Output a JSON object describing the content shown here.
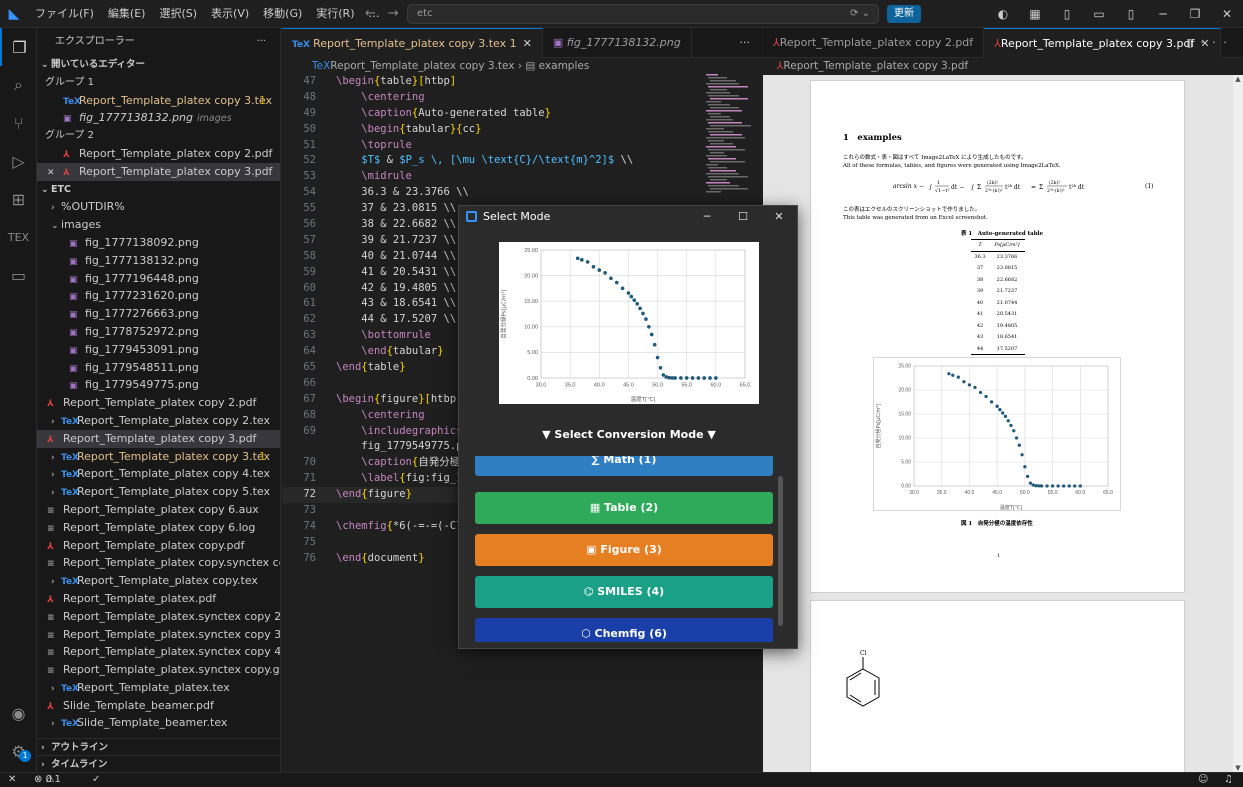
{
  "titlebar": {
    "menu": [
      "ファイル(F)",
      "編集(E)",
      "選択(S)",
      "表示(V)",
      "移動(G)",
      "実行(R)",
      "…"
    ],
    "search": "etc",
    "update_label": "更新"
  },
  "sidebar": {
    "header": "エクスプローラー",
    "open_editors_label": "開いているエディター",
    "group1_label": "グループ 1",
    "group1_items": [
      {
        "name": "Report_Template_platex copy 3.tex",
        "count": "1"
      },
      {
        "name": "fig_1777138132.png",
        "desc": "images"
      }
    ],
    "group2_label": "グループ 2",
    "group2_items": [
      {
        "name": "Report_Template_platex copy 2.pdf"
      },
      {
        "name": "Report_Template_platex copy 3.pdf"
      }
    ],
    "folder_label": "ETC",
    "folders": [
      "%OUTDIR%",
      "images"
    ],
    "images": [
      "fig_1777138092.png",
      "fig_1777138132.png",
      "fig_1777196448.png",
      "fig_1777231620.png",
      "fig_1777276663.png",
      "fig_1778752972.png",
      "fig_1779453091.png",
      "fig_1779548511.png",
      "fig_1779549775.png"
    ],
    "files": [
      {
        "name": "Report_Template_platex copy 2.pdf",
        "t": "pdf",
        "lv": 0
      },
      {
        "name": "Report_Template_platex copy 2.tex",
        "t": "tex",
        "lv": 1
      },
      {
        "name": "Report_Template_platex copy 3.pdf",
        "t": "pdf",
        "lv": 0,
        "sel": true
      },
      {
        "name": "Report_Template_platex copy 3.tex",
        "t": "tex",
        "lv": 1,
        "mod": true,
        "count": "1"
      },
      {
        "name": "Report_Template_platex copy 4.tex",
        "t": "tex",
        "lv": 1
      },
      {
        "name": "Report_Template_platex copy 5.tex",
        "t": "tex",
        "lv": 1
      },
      {
        "name": "Report_Template_platex copy 6.aux",
        "t": "file",
        "lv": 0
      },
      {
        "name": "Report_Template_platex copy 6.log",
        "t": "file",
        "lv": 0
      },
      {
        "name": "Report_Template_platex copy.pdf",
        "t": "pdf",
        "lv": 0
      },
      {
        "name": "Report_Template_platex copy.synctex copy.gz",
        "t": "file",
        "lv": 0
      },
      {
        "name": "Report_Template_platex copy.tex",
        "t": "tex",
        "lv": 1
      },
      {
        "name": "Report_Template_platex.pdf",
        "t": "pdf",
        "lv": 0
      },
      {
        "name": "Report_Template_platex.synctex copy 2.gz",
        "t": "file",
        "lv": 0
      },
      {
        "name": "Report_Template_platex.synctex copy 3.gz",
        "t": "file",
        "lv": 0
      },
      {
        "name": "Report_Template_platex.synctex copy 4.gz",
        "t": "file",
        "lv": 0
      },
      {
        "name": "Report_Template_platex.synctex copy.gz",
        "t": "file",
        "lv": 0
      },
      {
        "name": "Report_Template_platex.tex",
        "t": "tex",
        "lv": 1
      },
      {
        "name": "Slide_Template_beamer.pdf",
        "t": "pdf",
        "lv": 0
      },
      {
        "name": "Slide_Template_beamer.tex",
        "t": "tex",
        "lv": 1
      }
    ],
    "outline_label": "アウトライン",
    "timeline_label": "タイムライン"
  },
  "editor": {
    "tabs": [
      {
        "name": "Report_Template_platex copy 3.tex",
        "count": "1"
      },
      {
        "name": "fig_1777138132.png"
      }
    ],
    "breadcrumb_file": "Report_Template_platex copy 3.tex",
    "breadcrumb_sym": "examples",
    "lines": [
      {
        "n": "47",
        "t": "\\begin{table}[htbp]"
      },
      {
        "n": "48",
        "t": "    \\centering"
      },
      {
        "n": "49",
        "t": "    \\caption{Auto-generated table}"
      },
      {
        "n": "50",
        "t": "    \\begin{tabular}{cc}"
      },
      {
        "n": "51",
        "t": "    \\toprule"
      },
      {
        "n": "52",
        "t": "    $T$ & $P_s \\, [\\mu \\text{C}/\\text{m}^2]$ \\\\"
      },
      {
        "n": "53",
        "t": "    \\midrule"
      },
      {
        "n": "54",
        "t": "    36.3 & 23.3766 \\\\"
      },
      {
        "n": "55",
        "t": "    37 & 23.0815 \\\\"
      },
      {
        "n": "56",
        "t": "    38 & 22.6682 \\\\"
      },
      {
        "n": "57",
        "t": "    39 & 21.7237 \\\\"
      },
      {
        "n": "58",
        "t": "    40 & 21.0744 \\\\"
      },
      {
        "n": "59",
        "t": "    41 & 20.5431 \\\\"
      },
      {
        "n": "60",
        "t": "    42 & 19.4805 \\\\"
      },
      {
        "n": "61",
        "t": "    43 & 18.6541 \\\\"
      },
      {
        "n": "62",
        "t": "    44 & 17.5207 \\\\"
      },
      {
        "n": "63",
        "t": "    \\bottomrule"
      },
      {
        "n": "64",
        "t": "    \\end{tabular}"
      },
      {
        "n": "65",
        "t": "\\end{table}"
      },
      {
        "n": "66",
        "t": ""
      },
      {
        "n": "67",
        "t": "\\begin{figure}[htbp]"
      },
      {
        "n": "68",
        "t": "    \\centering"
      },
      {
        "n": "69",
        "t": "    \\includegraphics"
      },
      {
        "n": "",
        "t": "    fig_1779549775.p"
      },
      {
        "n": "70",
        "t": "    \\caption{自発分極"
      },
      {
        "n": "71",
        "t": "    \\label{fig:fig_1"
      },
      {
        "n": "72",
        "t": "\\end{figure}"
      },
      {
        "n": "73",
        "t": ""
      },
      {
        "n": "74",
        "t": "\\chemfig{*6(-=-=(-Cl"
      },
      {
        "n": "75",
        "t": ""
      },
      {
        "n": "76",
        "t": "\\end{document}"
      }
    ],
    "current_line": "72"
  },
  "preview": {
    "tabs": [
      {
        "name": "Report_Template_platex copy 2.pdf"
      },
      {
        "name": "Report_Template_platex copy 3.pdf"
      }
    ],
    "breadcrumb": "Report_Template_platex copy 3.pdf",
    "section": "1　examples",
    "para1": "これらの数式・表・図はすべて Image2LaTeX により生成したものです。",
    "para2": "All of these formulas, tables, and figures were generated using Image2LaTeX.",
    "eq_left": "arcsin x −",
    "eq_num": "(1)",
    "para3": "この表はエクセルのスクリーンショットで作りました。",
    "para4": "This table was generated from an Excel screenshot.",
    "table_caption": "表 1　Auto-generated table",
    "table_header": [
      "T",
      "Ps[μC/m²]"
    ],
    "table_rows": [
      [
        "36.3",
        "23.3766"
      ],
      [
        "37",
        "23.0815"
      ],
      [
        "38",
        "22.6682"
      ],
      [
        "39",
        "21.7237"
      ],
      [
        "40",
        "21.0744"
      ],
      [
        "41",
        "20.5431"
      ],
      [
        "42",
        "19.4805"
      ],
      [
        "43",
        "18.6541"
      ],
      [
        "44",
        "17.5207"
      ]
    ],
    "figure_caption": "図 1　自発分極の温度依存性",
    "page_number": "1",
    "chem_label": "Cl"
  },
  "chart_data": {
    "type": "scatter",
    "xlabel": "温度T[℃]",
    "ylabel": "自発分極Ps[μC/m²]",
    "xticks": [
      "30.0",
      "35.0",
      "40.0",
      "45.0",
      "50.0",
      "55.0",
      "60.0",
      "65.0"
    ],
    "yticks": [
      "0.00",
      "5.00",
      "10.00",
      "15.00",
      "20.00",
      "25.00"
    ],
    "xlim": [
      30,
      65
    ],
    "ylim": [
      0,
      25
    ],
    "grid": true,
    "color": "#1f5a7a",
    "x": [
      36.3,
      37,
      38,
      39,
      40,
      41,
      42,
      43,
      44,
      45,
      45.5,
      46,
      46.5,
      47,
      47.5,
      48,
      48.5,
      49,
      49.5,
      50,
      50.5,
      51,
      51.5,
      52,
      52.5,
      53,
      54,
      55,
      56,
      57,
      58,
      59,
      60
    ],
    "y": [
      23.38,
      23.08,
      22.67,
      21.72,
      21.07,
      20.54,
      19.48,
      18.65,
      17.52,
      16.6,
      15.9,
      15.2,
      14.5,
      13.6,
      12.6,
      11.5,
      10.0,
      8.5,
      6.5,
      4.0,
      2.0,
      0.6,
      0.2,
      0.05,
      0.02,
      0.01,
      0.0,
      0.0,
      0.0,
      0.0,
      0.0,
      0.0,
      0.0
    ]
  },
  "dialog": {
    "title": "Select Mode",
    "heading": "▼ Select Conversion Mode ▼",
    "modes": [
      {
        "label": "∑ Math (1)",
        "color": "#2f7ec1"
      },
      {
        "label": "▦ Table (2)",
        "color": "#2eaa5a"
      },
      {
        "label": "▣ Figure (3)",
        "color": "#e67e22"
      },
      {
        "label": "⌬ SMILES (4)",
        "color": "#1aa087"
      },
      {
        "label": "⬡ Chemfig (6)",
        "color": "#1a3fa8"
      }
    ]
  },
  "status": {
    "errors": "0",
    "warnings": "1"
  }
}
